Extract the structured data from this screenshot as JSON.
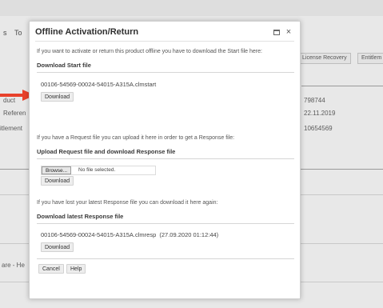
{
  "background": {
    "left_texts": [
      "s",
      "To",
      "duct",
      "Referen",
      "itlement",
      "are - He"
    ],
    "tabs": [
      "License Recovery",
      "Entitlem"
    ],
    "values": [
      "798744",
      "22.11.2019",
      "10654569"
    ]
  },
  "modal": {
    "title": "Offline Activation/Return",
    "maximize_icon": "maximize-icon",
    "close_glyph": "×",
    "intro": "If you want to activate or return this product offline you have to download the Start file here:",
    "start_section": {
      "heading": "Download Start file",
      "filename": "00106-54569-00024-54015-A315A.clmstart",
      "download_label": "Download"
    },
    "request_intro": "If you have a Request file you can upload it here in order to get a Response file:",
    "upload_section": {
      "heading": "Upload Request file and download Response file",
      "browse_label": "Browse...",
      "file_status": "No file selected.",
      "download_label": "Download"
    },
    "lost_intro": "If you have lost your latest Response file you can download it here again:",
    "response_section": {
      "heading": "Download latest Response file",
      "filename": "00106-54569-00024-54015-A315A.clmresp",
      "timestamp": "(27.09.2020 01:12:44)",
      "download_label": "Download"
    },
    "cancel_label": "Cancel",
    "help_label": "Help"
  },
  "colors": {
    "arrow": "#e8412b",
    "dim_background": "#e8e8e8",
    "modal_background": "#ffffff"
  }
}
